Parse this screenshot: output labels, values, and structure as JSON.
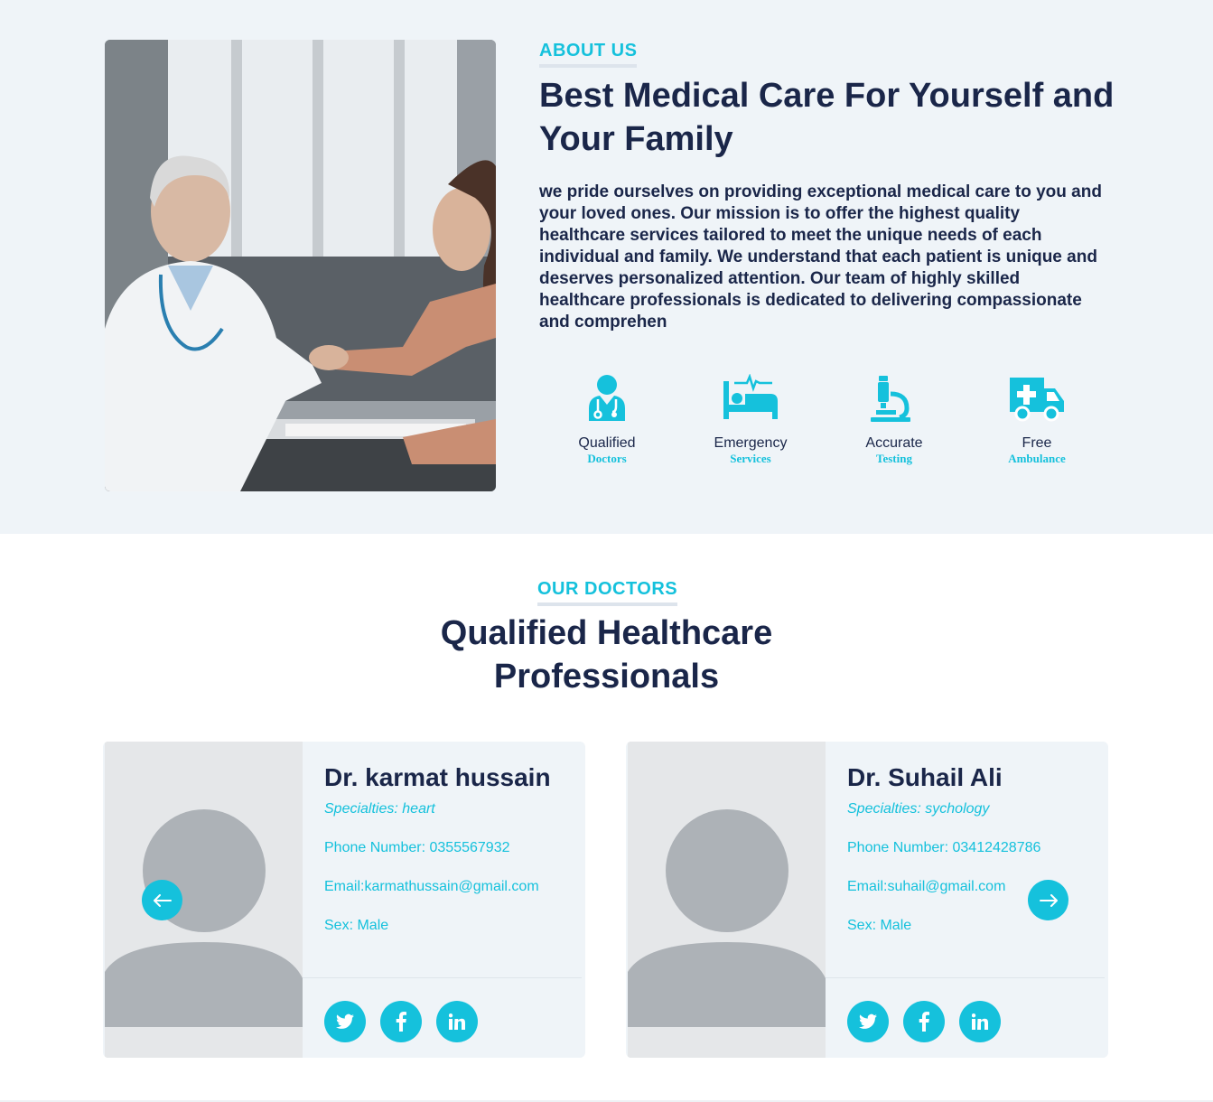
{
  "about": {
    "eyebrow": "ABOUT US",
    "title": "Best Medical Care For Yourself and Your Family",
    "description": "we pride ourselves on providing exceptional medical care to you and your loved ones. Our mission is to offer the highest quality healthcare services tailored to meet the unique needs of each individual and family. We understand that each patient is unique and deserves personalized attention. Our team of highly skilled healthcare professionals is dedicated to delivering compassionate and comprehen",
    "features": [
      {
        "title": "Qualified",
        "subtitle": "Doctors",
        "icon": "doctor-icon"
      },
      {
        "title": "Emergency",
        "subtitle": "Services",
        "icon": "hospital-bed-icon"
      },
      {
        "title": "Accurate",
        "subtitle": "Testing",
        "icon": "microscope-icon"
      },
      {
        "title": "Free",
        "subtitle": "Ambulance",
        "icon": "ambulance-icon"
      }
    ]
  },
  "doctors": {
    "eyebrow": "OUR DOCTORS",
    "title_line1": "Qualified Healthcare",
    "title_line2": "Professionals",
    "cards": [
      {
        "name": "Dr. karmat hussain",
        "specialties": "Specialties: heart",
        "phone": "Phone Number: 0355567932",
        "email": "Email:karmathussain@gmail.com",
        "sex": "Sex: Male"
      },
      {
        "name": "Dr. Suhail Ali",
        "specialties": "Specialties: sychology",
        "phone": "Phone Number: 03412428786",
        "email": "Email:suhail@gmail.com",
        "sex": "Sex: Male"
      }
    ],
    "socials": [
      "twitter-icon",
      "facebook-icon",
      "linkedin-icon"
    ],
    "prev_icon": "arrow-left-icon",
    "next_icon": "arrow-right-icon"
  },
  "colors": {
    "accent": "#15c1dc",
    "heading": "#1a2649",
    "section_bg": "#eff4f8"
  }
}
